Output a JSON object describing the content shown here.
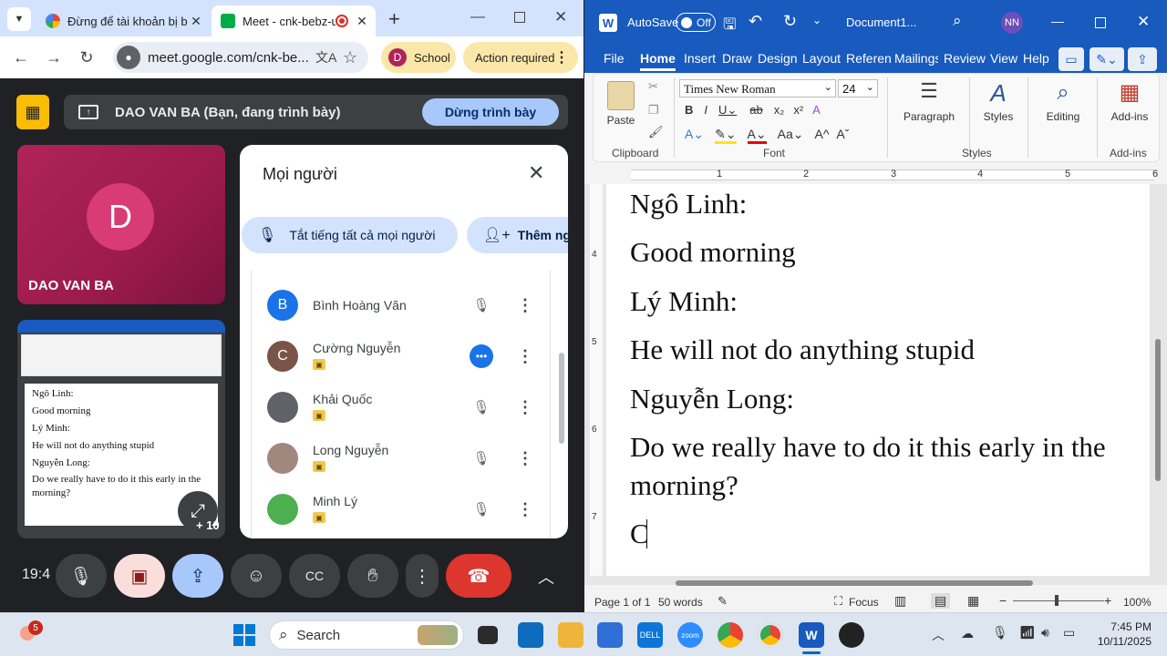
{
  "chrome": {
    "tabs": [
      {
        "title": "Đừng để tài khoản bị b",
        "color": "#ea4335"
      },
      {
        "title": "Meet - cnk-bebz-u",
        "color": "#00ac47"
      }
    ],
    "new_tab": "+",
    "url": "meet.google.com/cnk-be...",
    "profile_initial": "D",
    "profile_label": "School",
    "action_label": "Action required"
  },
  "meet": {
    "presenter_label": "DAO VAN BA (Bạn, đang trình bày)",
    "stop_label": "Dừng trình bày",
    "self_tile": {
      "initial": "D",
      "name": "DAO VAN BA"
    },
    "thumbnail": {
      "lines": [
        "Ngô Linh:",
        "Good morning",
        "Lý Minh:",
        "He will not do anything stupid",
        "Nguyễn Long:",
        "Do we really have to do it this early in the",
        "morning?"
      ],
      "extra_count": "+ 10"
    },
    "people_panel": {
      "title": "Mọi người",
      "mute_all_label": "Tắt tiếng tất cả mọi người",
      "add_label": "Thêm ngư",
      "people": [
        {
          "initial": "B",
          "name": "Bình Hoàng Văn",
          "color": "#1a73e8",
          "status": "muted",
          "badge": false
        },
        {
          "initial": "C",
          "name": "Cường Nguyễn",
          "color": "#795548",
          "status": "speaking",
          "badge": true
        },
        {
          "initial": "",
          "name": "Khải Quốc",
          "color": "#5f6368",
          "status": "muted",
          "badge": true
        },
        {
          "initial": "",
          "name": "Long Nguyễn",
          "color": "#a1887f",
          "status": "muted",
          "badge": true
        },
        {
          "initial": "",
          "name": "Minh Lý",
          "color": "#4caf50",
          "status": "muted",
          "badge": true
        }
      ]
    },
    "clock": "19:4"
  },
  "word": {
    "autosave_label": "AutoSave",
    "autosave_state": "Off",
    "doc_title": "Document1...",
    "user_initials": "NN",
    "tabs": [
      "File",
      "Home",
      "Insert",
      "Draw",
      "Design",
      "Layout",
      "Referenc",
      "Mailings",
      "Review",
      "View",
      "Help"
    ],
    "active_tab": "Home",
    "ribbon": {
      "paste_label": "Paste",
      "clipboard_label": "Clipboard",
      "font_name": "Times New Roman",
      "font_size": "24",
      "font_label": "Font",
      "paragraph_label": "Paragraph",
      "styles_label": "Styles",
      "styles_group_label": "Styles",
      "editing_label": "Editing",
      "addins_label": "Add-ins",
      "addins_group_label": "Add-ins"
    },
    "ruler_numbers": [
      "1",
      "2",
      "3",
      "4",
      "5",
      "6"
    ],
    "vruler_numbers": [
      "4",
      "5",
      "6",
      "7"
    ],
    "document_lines": [
      "Ngô Linh:",
      "Good morning",
      "Lý Minh:",
      "He will not do anything stupid",
      "Nguyễn Long:",
      "Do we really have to do it this early in the",
      "morning?",
      "C"
    ],
    "status": {
      "page": "Page 1 of 1",
      "words": "50 words",
      "focus": "Focus",
      "zoom": "100%"
    }
  },
  "taskbar": {
    "notification_count": "5",
    "search_placeholder": "Search",
    "time": "7:45 PM",
    "date": "10/11/2025"
  }
}
